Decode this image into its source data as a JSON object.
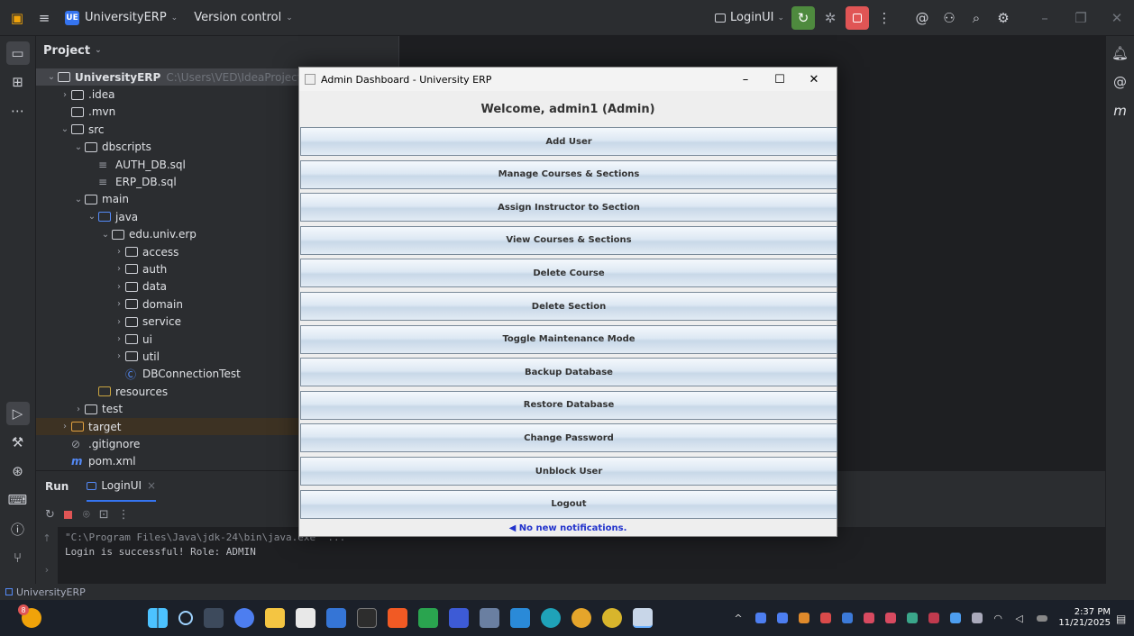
{
  "ide": {
    "project_badge": "UE",
    "project_name": "UniversityERP",
    "vcs_label": "Version control",
    "run_config": "LoginUI",
    "panel_title": "Project"
  },
  "tree": [
    {
      "indent": 0,
      "chev": "v",
      "icon": "module",
      "label": "UniversityERP",
      "path": "C:\\Users\\VED\\IdeaProjects\\Unive",
      "bold": true
    },
    {
      "indent": 1,
      "chev": ">",
      "icon": "folder",
      "label": ".idea"
    },
    {
      "indent": 1,
      "chev": "",
      "icon": "folder",
      "label": ".mvn"
    },
    {
      "indent": 1,
      "chev": "v",
      "icon": "folder",
      "label": "src"
    },
    {
      "indent": 2,
      "chev": "v",
      "icon": "folder",
      "label": "dbscripts"
    },
    {
      "indent": 3,
      "chev": "",
      "icon": "file",
      "label": "AUTH_DB.sql"
    },
    {
      "indent": 3,
      "chev": "",
      "icon": "file",
      "label": "ERP_DB.sql"
    },
    {
      "indent": 2,
      "chev": "v",
      "icon": "folder",
      "label": "main"
    },
    {
      "indent": 3,
      "chev": "v",
      "icon": "folder-blue",
      "label": "java"
    },
    {
      "indent": 4,
      "chev": "v",
      "icon": "package",
      "label": "edu.univ.erp"
    },
    {
      "indent": 5,
      "chev": ">",
      "icon": "package",
      "label": "access"
    },
    {
      "indent": 5,
      "chev": ">",
      "icon": "package",
      "label": "auth"
    },
    {
      "indent": 5,
      "chev": ">",
      "icon": "package",
      "label": "data"
    },
    {
      "indent": 5,
      "chev": ">",
      "icon": "package",
      "label": "domain"
    },
    {
      "indent": 5,
      "chev": ">",
      "icon": "package",
      "label": "service"
    },
    {
      "indent": 5,
      "chev": ">",
      "icon": "package",
      "label": "ui"
    },
    {
      "indent": 5,
      "chev": ">",
      "icon": "package",
      "label": "util"
    },
    {
      "indent": 5,
      "chev": "",
      "icon": "class",
      "label": "DBConnectionTest"
    },
    {
      "indent": 3,
      "chev": "",
      "icon": "resources",
      "label": "resources"
    },
    {
      "indent": 2,
      "chev": ">",
      "icon": "folder",
      "label": "test"
    },
    {
      "indent": 1,
      "chev": ">",
      "icon": "folder-orange",
      "label": "target",
      "hl": true
    },
    {
      "indent": 1,
      "chev": "",
      "icon": "gitignore",
      "label": ".gitignore"
    },
    {
      "indent": 1,
      "chev": "",
      "icon": "maven",
      "label": "pom.xml"
    }
  ],
  "run": {
    "tab_run": "Run",
    "tab_config": "LoginUI",
    "tab_close": "×",
    "console_line1": "\"C:\\Program Files\\Java\\jdk-24\\bin\\java.exe\" ...",
    "console_line2": "Login is successful! Role: ADMIN"
  },
  "status": {
    "project": "UniversityERP"
  },
  "dialog": {
    "title": "Admin Dashboard - University ERP",
    "minimize": "–",
    "maximize": "☐",
    "close": "✕",
    "welcome": "Welcome, admin1 (Admin)",
    "buttons": [
      "Add User",
      "Manage Courses & Sections",
      "Assign Instructor to Section",
      "View Courses & Sections",
      "Delete Course",
      "Delete Section",
      "Toggle Maintenance Mode",
      "Backup Database",
      "Restore Database",
      "Change Password",
      "Unblock User",
      "Logout"
    ],
    "notification": "No new notifications."
  },
  "taskbar": {
    "time": "2:37 PM",
    "date": "11/21/2025",
    "notification_count": "8"
  },
  "colors": {
    "ide_bg": "#1e1f22",
    "panel_bg": "#2b2d30",
    "accent_blue": "#3574f0",
    "run_green": "#4e8a3e",
    "stop_red": "#e05555",
    "notif_blue": "#2233cc"
  }
}
